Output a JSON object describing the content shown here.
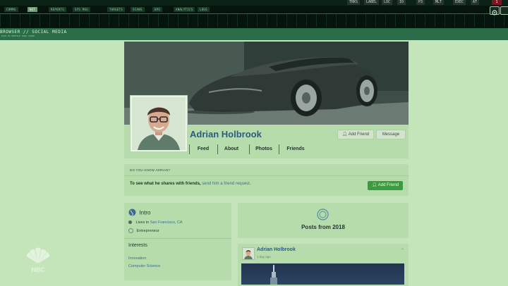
{
  "hud": {
    "tabs": [
      "COMMS",
      "NET",
      "REPORTS",
      "SYS MSG",
      "TARGETS",
      "SCANS",
      "OPS",
      "ANALYTICS",
      "LOGS"
    ],
    "right_tabs": [
      "TRKS",
      "LABEL",
      "LOC",
      "IO",
      "P3",
      "MLT",
      "EXEC",
      "AT"
    ],
    "alert_label": "1"
  },
  "browser": {
    "title": "BROWSER // SOCIAL MEDIA",
    "subtitle": "FILE 01 PROFILE PAGE CACHE"
  },
  "profile": {
    "name": "Adrian Holbrook",
    "add_friend": "Add Friend",
    "message": "Message",
    "tabs": [
      "Feed",
      "About",
      "Photos",
      "Friends"
    ]
  },
  "know": {
    "heading": "DO YOU KNOW ADRIAN?",
    "text": "To see what he shares with friends,",
    "link": "send him a friend request.",
    "button": "Add Friend"
  },
  "intro": {
    "title": "Intro",
    "lives_prefix": "Lives in",
    "city": "San Francisco, CA",
    "job": "Entrepreneur",
    "interests_title": "Interests",
    "interests": [
      "Innovation",
      "Computer Science"
    ]
  },
  "posts": {
    "title": "Posts from 2018"
  },
  "post": {
    "author": "Adrian Holbrook",
    "time": "1 day ago"
  },
  "watermark": {
    "text": "NBC"
  },
  "colors": {
    "page_bg": "#c3e5b9",
    "card_bg": "#b7dcac",
    "name_blue": "#2e5a7c",
    "link_blue": "#3b6d8e",
    "green_button": "#3c9b3f",
    "hud_dark": "#05140d",
    "hud_green": "#2b6d48"
  }
}
